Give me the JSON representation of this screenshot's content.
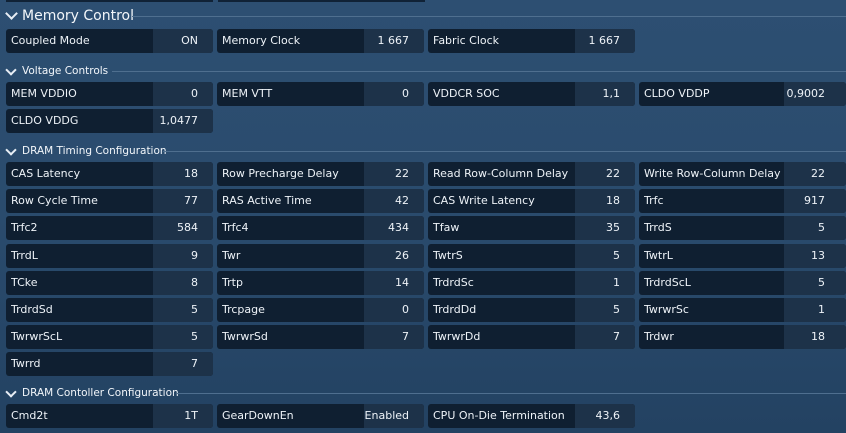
{
  "memory_control": {
    "title": "Memory Control",
    "items": [
      {
        "label": "Coupled Mode",
        "value": "ON"
      },
      {
        "label": "Memory Clock",
        "value": "1 667"
      },
      {
        "label": "Fabric Clock",
        "value": "1 667"
      }
    ]
  },
  "voltage_controls": {
    "title": "Voltage Controls",
    "items": [
      {
        "label": "MEM VDDIO",
        "value": "0"
      },
      {
        "label": "MEM VTT",
        "value": "0"
      },
      {
        "label": "VDDCR SOC",
        "value": "1,1"
      },
      {
        "label": "CLDO VDDP",
        "value": "0,9002"
      },
      {
        "label": "CLDO VDDG",
        "value": "1,0477"
      }
    ]
  },
  "dram_timing": {
    "title": "DRAM Timing Configuration",
    "items": [
      {
        "label": "CAS Latency",
        "value": "18"
      },
      {
        "label": "Row Precharge Delay",
        "value": "22"
      },
      {
        "label": "Read Row-Column Delay",
        "value": "22"
      },
      {
        "label": "Write Row-Column Delay",
        "value": "22"
      },
      {
        "label": "Row Cycle Time",
        "value": "77"
      },
      {
        "label": "RAS Active Time",
        "value": "42"
      },
      {
        "label": "CAS Write Latency",
        "value": "18"
      },
      {
        "label": "Trfc",
        "value": "917"
      },
      {
        "label": "Trfc2",
        "value": "584"
      },
      {
        "label": "Trfc4",
        "value": "434"
      },
      {
        "label": "Tfaw",
        "value": "35"
      },
      {
        "label": "TrrdS",
        "value": "5"
      },
      {
        "label": "TrrdL",
        "value": "9"
      },
      {
        "label": "Twr",
        "value": "26"
      },
      {
        "label": "TwtrS",
        "value": "5"
      },
      {
        "label": "TwtrL",
        "value": "13"
      },
      {
        "label": "TCke",
        "value": "8"
      },
      {
        "label": "Trtp",
        "value": "14"
      },
      {
        "label": "TrdrdSc",
        "value": "1"
      },
      {
        "label": "TrdrdScL",
        "value": "5"
      },
      {
        "label": "TrdrdSd",
        "value": "5"
      },
      {
        "label": "Trcpage",
        "value": "0"
      },
      {
        "label": "TrdrdDd",
        "value": "5"
      },
      {
        "label": "TwrwrSc",
        "value": "1"
      },
      {
        "label": "TwrwrScL",
        "value": "5"
      },
      {
        "label": "TwrwrSd",
        "value": "7"
      },
      {
        "label": "TwrwrDd",
        "value": "7"
      },
      {
        "label": "Trdwr",
        "value": "18"
      },
      {
        "label": "Twrrd",
        "value": "7"
      }
    ]
  },
  "dram_controller": {
    "title": "DRAM Contoller Configuration",
    "items": [
      {
        "label": "Cmd2t",
        "value": "1T"
      },
      {
        "label": "GearDownEn",
        "value": "Enabled"
      },
      {
        "label": "CPU On-Die Termination",
        "value": "43,6"
      }
    ]
  }
}
